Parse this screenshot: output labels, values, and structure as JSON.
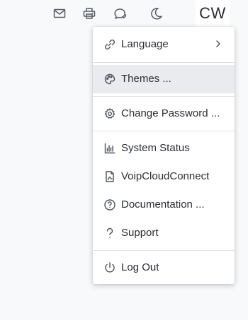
{
  "header": {
    "icons": [
      "mail-icon",
      "printer-icon",
      "chat-icon",
      "dark-mode-icon"
    ],
    "avatar_initials": "CW"
  },
  "menu": {
    "items": [
      {
        "label": "Language",
        "icon": "link-icon",
        "has_submenu": true
      },
      {
        "label": "Themes ...",
        "icon": "palette-icon",
        "highlighted": true
      },
      {
        "label": "Change Password ...",
        "icon": "gear-icon"
      },
      {
        "label": "System Status",
        "icon": "bar-chart-icon"
      },
      {
        "label": "VoipCloudConnect",
        "icon": "document-icon"
      },
      {
        "label": "Documentation ...",
        "icon": "help-circle-icon"
      },
      {
        "label": "Support",
        "icon": "question-mark-icon"
      },
      {
        "label": "Log Out",
        "icon": "power-icon"
      }
    ]
  },
  "colors": {
    "background": "#f8f9fb",
    "menu_background": "#ffffff",
    "highlight": "#e9ebee",
    "divider": "#dfe1e5",
    "text": "#2b2d33"
  }
}
